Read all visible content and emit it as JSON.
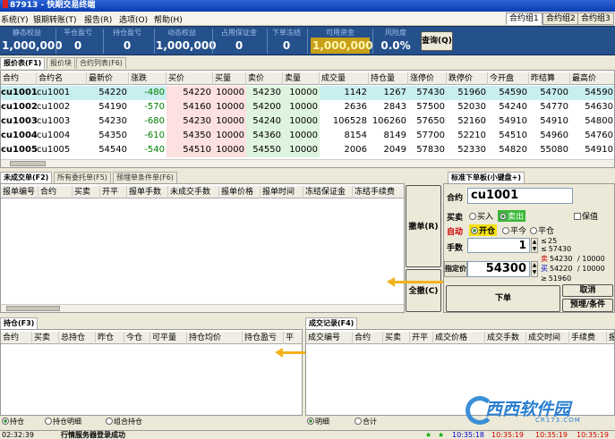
{
  "window": {
    "title": "87913 - 快期交易终端"
  },
  "menu": {
    "items": [
      "系统(Y)",
      "银期转账(T)",
      "报告(R)",
      "选项(O)",
      "帮助(H)"
    ]
  },
  "account_tabs": [
    "合约组1",
    "合约组2",
    "合约组3"
  ],
  "summary": {
    "fields": [
      {
        "label": "静态权益",
        "value": "1,000,000"
      },
      {
        "label": "平仓盈亏",
        "value": "0"
      },
      {
        "label": "持仓盈亏",
        "value": "0"
      },
      {
        "label": "动态权益",
        "value": "1,000,000"
      },
      {
        "label": "占用保证金",
        "value": "0"
      },
      {
        "label": "下单冻结",
        "value": "0"
      },
      {
        "label": "可用资金",
        "value": "1,000,000"
      },
      {
        "label": "风险度",
        "value": "0.0%"
      }
    ],
    "query_button": "查询(Q)"
  },
  "quote_tabs": [
    "报价表(F1)",
    "报价块",
    "合约列表(F6)"
  ],
  "quote": {
    "headers": [
      "合约",
      "合约名",
      "最新价",
      "涨跌",
      "买价",
      "买量",
      "卖价",
      "卖量",
      "成交量",
      "持仓量",
      "涨停价",
      "跌停价",
      "今开盘",
      "昨结算",
      "最高价"
    ],
    "rows": [
      [
        "cu1001",
        "cu1001",
        "54220",
        "-480",
        "54220",
        "10000",
        "54230",
        "10000",
        "1142",
        "1267",
        "57430",
        "51960",
        "54590",
        "54700",
        "54590"
      ],
      [
        "cu1002",
        "cu1002",
        "54190",
        "-570",
        "54160",
        "10000",
        "54200",
        "10000",
        "2636",
        "2843",
        "57500",
        "52030",
        "54240",
        "54770",
        "54630"
      ],
      [
        "cu1003",
        "cu1003",
        "54230",
        "-680",
        "54230",
        "10000",
        "54240",
        "10000",
        "106528",
        "106260",
        "57650",
        "52160",
        "54910",
        "54910",
        "54800"
      ],
      [
        "cu1004",
        "cu1004",
        "54350",
        "-610",
        "54350",
        "10000",
        "54360",
        "10000",
        "8154",
        "8149",
        "57700",
        "52210",
        "54510",
        "54960",
        "54760"
      ],
      [
        "cu1005",
        "cu1005",
        "54540",
        "-540",
        "54510",
        "10000",
        "54550",
        "10000",
        "2006",
        "2049",
        "57830",
        "52330",
        "54820",
        "55080",
        "54910"
      ]
    ]
  },
  "orders": {
    "tabs": [
      "未成交单(F2)",
      "所有委托单(F5)",
      "预埋单条件单(F6)"
    ],
    "headers": [
      "报单编号",
      "合约",
      "买卖",
      "开平",
      "报单手数",
      "未成交手数",
      "报单价格",
      "报单时间",
      "冻结保证金",
      "冻结手续费"
    ],
    "cancel_button": "撤单(R)",
    "cancel_all_button": "全撤(C)"
  },
  "order_panel": {
    "tab": "标准下单板(小键盘+)",
    "contract_label": "合约",
    "contract_value": "cu1001",
    "buysell_label": "买卖",
    "buy": "买入",
    "sell": "卖出",
    "preserve": "保值",
    "auto_label": "自动",
    "open": "开仓",
    "close_today": "平今",
    "close": "平仓",
    "qty_label": "手数",
    "qty_value": "1",
    "qty_hint_top": "≤",
    "qty_hint_val": "25",
    "price_label": "指定价",
    "price_value": "54300",
    "limits": [
      {
        "mark": "≤",
        "price": "57430",
        "vol": ""
      },
      {
        "mark": "卖",
        "price": "54230",
        "vol": "/ 10000"
      },
      {
        "mark": "买",
        "price": "54220",
        "vol": "/ 10000"
      },
      {
        "mark": "≥",
        "price": "51960",
        "vol": ""
      }
    ],
    "submit_button": "下单",
    "cancel_button": "取消",
    "preset_button": "预埋/条件"
  },
  "positions": {
    "tab": "持仓(F3)",
    "headers": [
      "合约",
      "买卖",
      "总持仓",
      "昨仓",
      "今仓",
      "可平量",
      "持仓均价",
      "持仓盈亏",
      "平"
    ],
    "bottom_tabs": [
      "持仓",
      "持仓明细",
      "组合持仓"
    ]
  },
  "trades": {
    "tab": "成交记录(F4)",
    "headers": [
      "成交编号",
      "合约",
      "买卖",
      "开平",
      "成交价格",
      "成交手数",
      "成交时间",
      "手续费",
      "报"
    ],
    "bottom_tabs": [
      "明细",
      "合计"
    ]
  },
  "status": {
    "time": "02:32:39",
    "message": "行情服务器登录成功",
    "times": [
      "10:35:18",
      "10:35:19",
      "10:35:19",
      "10:35:19"
    ]
  },
  "watermark": {
    "brand": "西西软件园",
    "url": "CR173.COM"
  },
  "colors": {
    "down": "#008000",
    "summary_bg": "#24508c",
    "bid_bg": "#fde0e0",
    "ask_bg": "#def4de",
    "arrow": "#f4b21c"
  }
}
